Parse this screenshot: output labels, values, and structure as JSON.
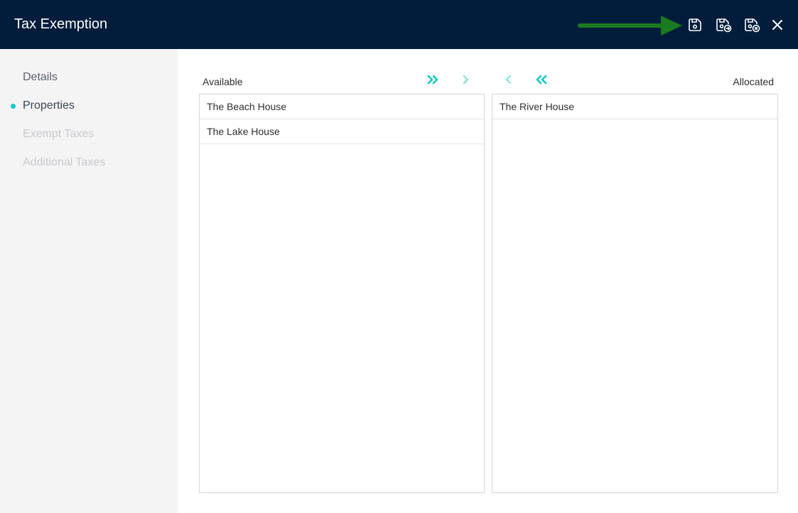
{
  "header": {
    "title": "Tax Exemption",
    "icons": [
      "save-icon",
      "save-and-exit-icon",
      "save-and-cancel-icon",
      "close-icon"
    ]
  },
  "sidebar": {
    "items": [
      {
        "label": "Details",
        "state": "default"
      },
      {
        "label": "Properties",
        "state": "active"
      },
      {
        "label": "Exempt Taxes",
        "state": "disabled"
      },
      {
        "label": "Additional Taxes",
        "state": "disabled"
      }
    ]
  },
  "available": {
    "label": "Available",
    "items": [
      "The Beach House",
      "The Lake House"
    ]
  },
  "allocated": {
    "label": "Allocated",
    "items": [
      "The River House"
    ]
  },
  "colors": {
    "header_bg": "#021c3b",
    "accent": "#13c7c7",
    "annotation_arrow": "#1a7a1f",
    "sidebar_bg": "#f4f4f5"
  }
}
